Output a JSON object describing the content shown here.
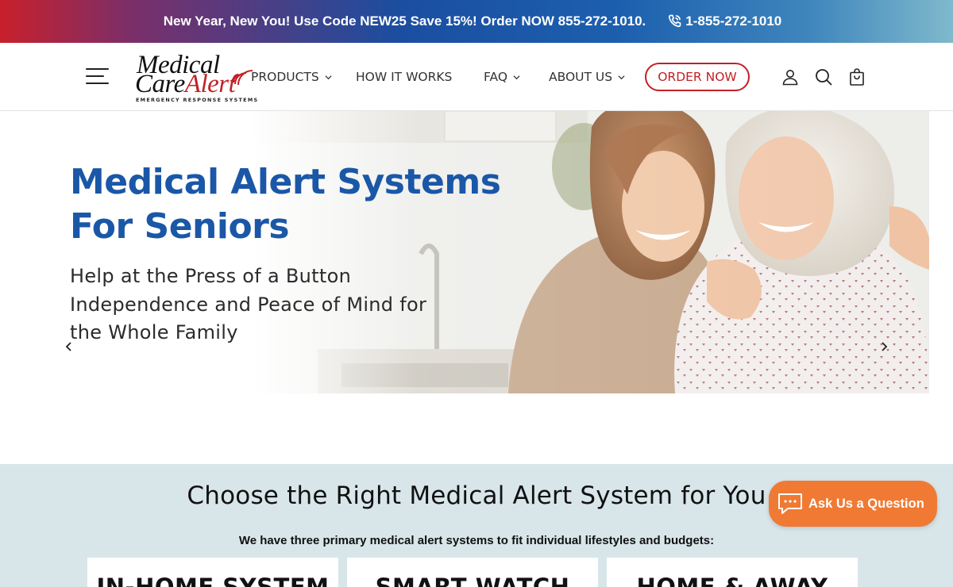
{
  "promo": {
    "text": "New Year, New You! Use Code NEW25 Save 15%! Order NOW 855-272-1010.",
    "phone": "1-855-272-1010",
    "icon": "phone-icon"
  },
  "header": {
    "logo": {
      "line1": "Medical",
      "line2_a": "Care",
      "line2_b": "Alert",
      "tagline": "EMERGENCY RESPONSE SYSTEMS"
    },
    "nav": {
      "products": "PRODUCTS",
      "how_it_works": "HOW IT WORKS",
      "faq": "FAQ",
      "about_us": "ABOUT US"
    },
    "order_now": "ORDER NOW",
    "icons": [
      "menu-icon",
      "account-icon",
      "search-icon",
      "cart-icon"
    ]
  },
  "hero": {
    "title_line1": "Medical Alert Systems",
    "title_line2": "For Seniors",
    "sub_line1": "Help at the Press of a Button",
    "sub_line2": "Independence and Peace of Mind for",
    "sub_line3": "the Whole Family"
  },
  "choose": {
    "title": "Choose the Right Medical Alert System for You",
    "subtitle": "We have three primary medical alert systems to fit individual lifestyles and budgets:",
    "cards": [
      "IN-HOME SYSTEM",
      "SMART WATCH",
      "HOME & AWAY"
    ]
  },
  "ask": {
    "label": "Ask Us a Question"
  },
  "colors": {
    "brand_blue": "#1a57a7",
    "brand_red": "#c32025",
    "ask_orange": "#f07a34",
    "section_bg": "#d8e6ea"
  }
}
